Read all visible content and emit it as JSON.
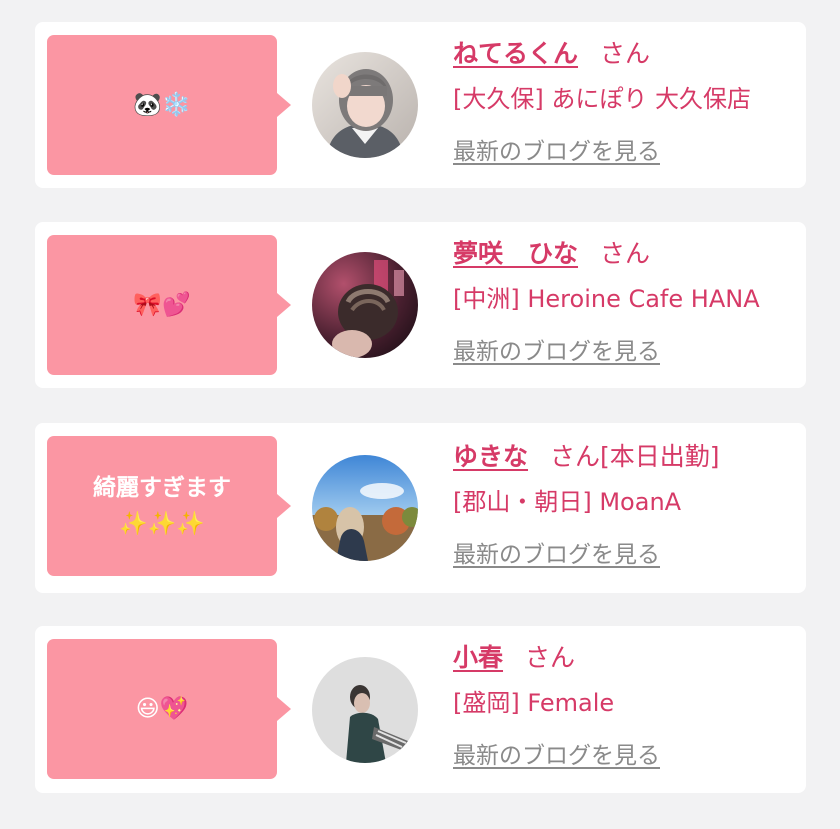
{
  "cards": [
    {
      "comment": "🐼❄️",
      "name": "ねてるくん",
      "honorific": "さん",
      "status": "",
      "shop": "[大久保] あにぽり 大久保店",
      "blog_link": "最新のブログを見る"
    },
    {
      "comment": "🎀💕",
      "name": "夢咲　ひな",
      "honorific": "さん",
      "status": "",
      "shop": "[中洲] Heroine Cafe HANA",
      "blog_link": "最新のブログを見る"
    },
    {
      "comment": "綺麗すぎます\n✨✨✨",
      "name": "ゆきな",
      "honorific": "さん",
      "status": "[本日出勤]",
      "shop": "[郡山・朝日] MoanA",
      "blog_link": "最新のブログを見る"
    },
    {
      "comment": "😃💖",
      "name": "小春",
      "honorific": "さん",
      "status": "",
      "shop": "[盛岡] Female",
      "blog_link": "最新のブログを見る"
    }
  ],
  "colors": {
    "accent": "#d63a67",
    "bubble": "#fb96a3",
    "link_gray": "#8a8a8a",
    "background": "#f2f2f3"
  }
}
